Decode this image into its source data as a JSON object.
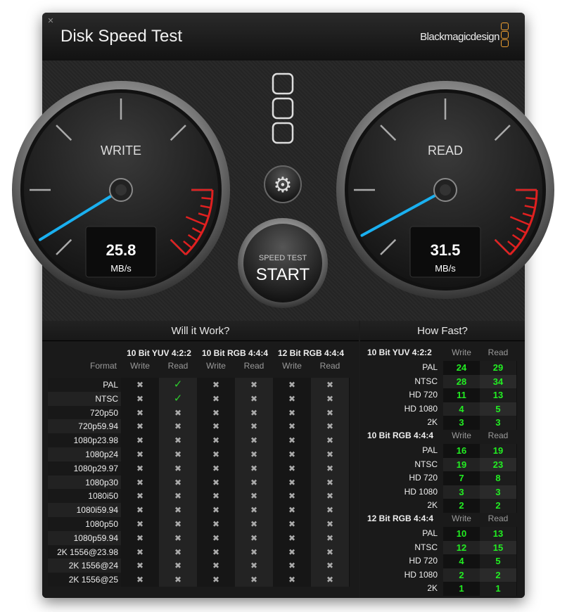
{
  "window": {
    "title": "Disk Speed Test",
    "brand": "Blackmagicdesign",
    "close_icon": "close-icon"
  },
  "gauges": {
    "write": {
      "label": "WRITE",
      "value": "25.8",
      "unit": "MB/s",
      "needle_color": "#1ab0f0"
    },
    "read": {
      "label": "READ",
      "value": "31.5",
      "unit": "MB/s",
      "needle_color": "#1ab0f0"
    }
  },
  "start_button": {
    "top": "SPEED TEST",
    "main": "START"
  },
  "settings_icon": "gear-icon",
  "will_it_work": {
    "title": "Will it Work?",
    "format_header": "Format",
    "groups": [
      "10 Bit YUV 4:2:2",
      "10 Bit RGB 4:4:4",
      "12 Bit RGB 4:4:4"
    ],
    "subheaders": [
      "Write",
      "Read",
      "Write",
      "Read",
      "Write",
      "Read"
    ],
    "rows": [
      {
        "format": "PAL",
        "cells": [
          "x",
          "ok",
          "x",
          "x",
          "x",
          "x"
        ]
      },
      {
        "format": "NTSC",
        "cells": [
          "x",
          "ok",
          "x",
          "x",
          "x",
          "x"
        ]
      },
      {
        "format": "720p50",
        "cells": [
          "x",
          "x",
          "x",
          "x",
          "x",
          "x"
        ]
      },
      {
        "format": "720p59.94",
        "cells": [
          "x",
          "x",
          "x",
          "x",
          "x",
          "x"
        ]
      },
      {
        "format": "1080p23.98",
        "cells": [
          "x",
          "x",
          "x",
          "x",
          "x",
          "x"
        ]
      },
      {
        "format": "1080p24",
        "cells": [
          "x",
          "x",
          "x",
          "x",
          "x",
          "x"
        ]
      },
      {
        "format": "1080p29.97",
        "cells": [
          "x",
          "x",
          "x",
          "x",
          "x",
          "x"
        ]
      },
      {
        "format": "1080p30",
        "cells": [
          "x",
          "x",
          "x",
          "x",
          "x",
          "x"
        ]
      },
      {
        "format": "1080i50",
        "cells": [
          "x",
          "x",
          "x",
          "x",
          "x",
          "x"
        ]
      },
      {
        "format": "1080i59.94",
        "cells": [
          "x",
          "x",
          "x",
          "x",
          "x",
          "x"
        ]
      },
      {
        "format": "1080p50",
        "cells": [
          "x",
          "x",
          "x",
          "x",
          "x",
          "x"
        ]
      },
      {
        "format": "1080p59.94",
        "cells": [
          "x",
          "x",
          "x",
          "x",
          "x",
          "x"
        ]
      },
      {
        "format": "2K 1556@23.98",
        "cells": [
          "x",
          "x",
          "x",
          "x",
          "x",
          "x"
        ]
      },
      {
        "format": "2K 1556@24",
        "cells": [
          "x",
          "x",
          "x",
          "x",
          "x",
          "x"
        ]
      },
      {
        "format": "2K 1556@25",
        "cells": [
          "x",
          "x",
          "x",
          "x",
          "x",
          "x"
        ]
      }
    ],
    "symbols": {
      "x": "✖",
      "ok": "✓"
    }
  },
  "how_fast": {
    "title": "How Fast?",
    "sections": [
      {
        "name": "10 Bit YUV 4:2:2",
        "write": "Write",
        "read": "Read",
        "rows": [
          {
            "format": "PAL",
            "write": "24",
            "read": "29"
          },
          {
            "format": "NTSC",
            "write": "28",
            "read": "34"
          },
          {
            "format": "HD 720",
            "write": "11",
            "read": "13"
          },
          {
            "format": "HD 1080",
            "write": "4",
            "read": "5"
          },
          {
            "format": "2K",
            "write": "3",
            "read": "3"
          }
        ]
      },
      {
        "name": "10 Bit RGB 4:4:4",
        "write": "Write",
        "read": "Read",
        "rows": [
          {
            "format": "PAL",
            "write": "16",
            "read": "19"
          },
          {
            "format": "NTSC",
            "write": "19",
            "read": "23"
          },
          {
            "format": "HD 720",
            "write": "7",
            "read": "8"
          },
          {
            "format": "HD 1080",
            "write": "3",
            "read": "3"
          },
          {
            "format": "2K",
            "write": "2",
            "read": "2"
          }
        ]
      },
      {
        "name": "12 Bit RGB 4:4:4",
        "write": "Write",
        "read": "Read",
        "rows": [
          {
            "format": "PAL",
            "write": "10",
            "read": "13"
          },
          {
            "format": "NTSC",
            "write": "12",
            "read": "15"
          },
          {
            "format": "HD 720",
            "write": "4",
            "read": "5"
          },
          {
            "format": "HD 1080",
            "write": "2",
            "read": "2"
          },
          {
            "format": "2K",
            "write": "1",
            "read": "1"
          }
        ]
      }
    ]
  }
}
